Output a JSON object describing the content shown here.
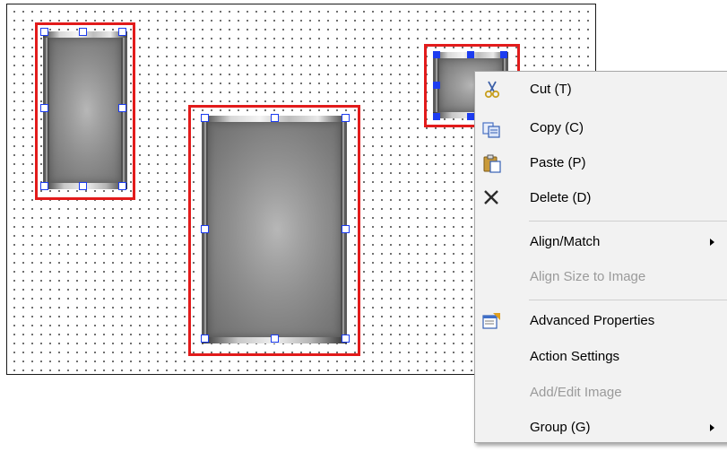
{
  "colors": {
    "selection": "#e21b1b",
    "handle": "#1c3cf0",
    "menu_bg": "#f2f2f2",
    "disabled_text": "#9a9a9a"
  },
  "canvas": {
    "objects": [
      {
        "name": "image-frame-left",
        "handles": "white"
      },
      {
        "name": "image-frame-center",
        "handles": "white"
      },
      {
        "name": "image-frame-small",
        "handles": "blue"
      }
    ]
  },
  "context_menu": {
    "items": [
      {
        "label": "Cut (T)",
        "mnemonic": "T",
        "icon": "scissors-icon",
        "enabled": true
      },
      {
        "label": "Copy (C)",
        "mnemonic": "C",
        "icon": "copy-icon",
        "enabled": true
      },
      {
        "label": "Paste (P)",
        "mnemonic": "P",
        "icon": "paste-icon",
        "enabled": true
      },
      {
        "label": "Delete (D)",
        "mnemonic": "D",
        "icon": "delete-x-icon",
        "enabled": true
      },
      {
        "label": "Align/Match",
        "submenu": true,
        "enabled": true
      },
      {
        "label": "Align Size to Image",
        "enabled": false
      },
      {
        "label": "Advanced Properties",
        "icon": "properties-icon",
        "enabled": true
      },
      {
        "label": "Action Settings",
        "enabled": true
      },
      {
        "label": "Add/Edit Image",
        "enabled": false
      },
      {
        "label": "Group (G)",
        "mnemonic": "G",
        "submenu": true,
        "enabled": true
      }
    ]
  }
}
